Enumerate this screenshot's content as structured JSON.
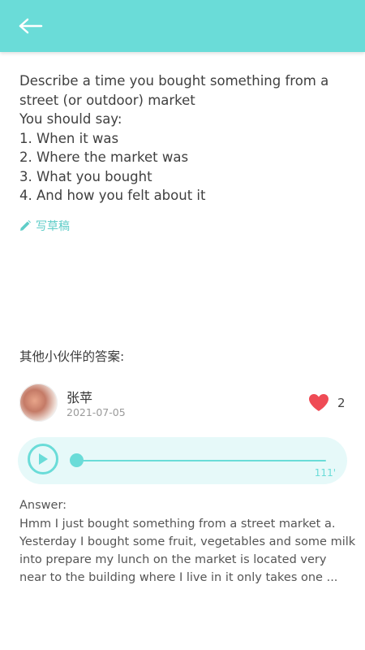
{
  "header": {
    "back_icon": "arrow-left-icon",
    "background": "#6adcd8"
  },
  "question": {
    "line1": "Describe a time you bought something from a street (or outdoor) market",
    "line2": "You should say:",
    "line3": "1. When it was",
    "line4": "2. Where the market was",
    "line5": "3. What you bought",
    "line6": "4. And how you felt about it"
  },
  "draft": {
    "label": "写草稿",
    "icon": "pencil-icon"
  },
  "others": {
    "title": "其他小伙伴的答案:"
  },
  "answer_card": {
    "username": "张苹",
    "date": "2021-07-05",
    "like_count": "2",
    "like_icon": "heart-icon",
    "audio": {
      "duration": "111'",
      "progress": 0.0
    },
    "answer_label": "Answer:",
    "answer_lines": [
      "Hmm I just bought something from a street market a.",
      "Yesterday I bought some fruit, vegetables and some milk",
      "into prepare my lunch on the market is located very",
      "near to the building where I live in it only takes one ..."
    ]
  },
  "colors": {
    "accent": "#6adcd8",
    "accent_light": "#e6f9f9",
    "heart": "#ef4b55"
  }
}
